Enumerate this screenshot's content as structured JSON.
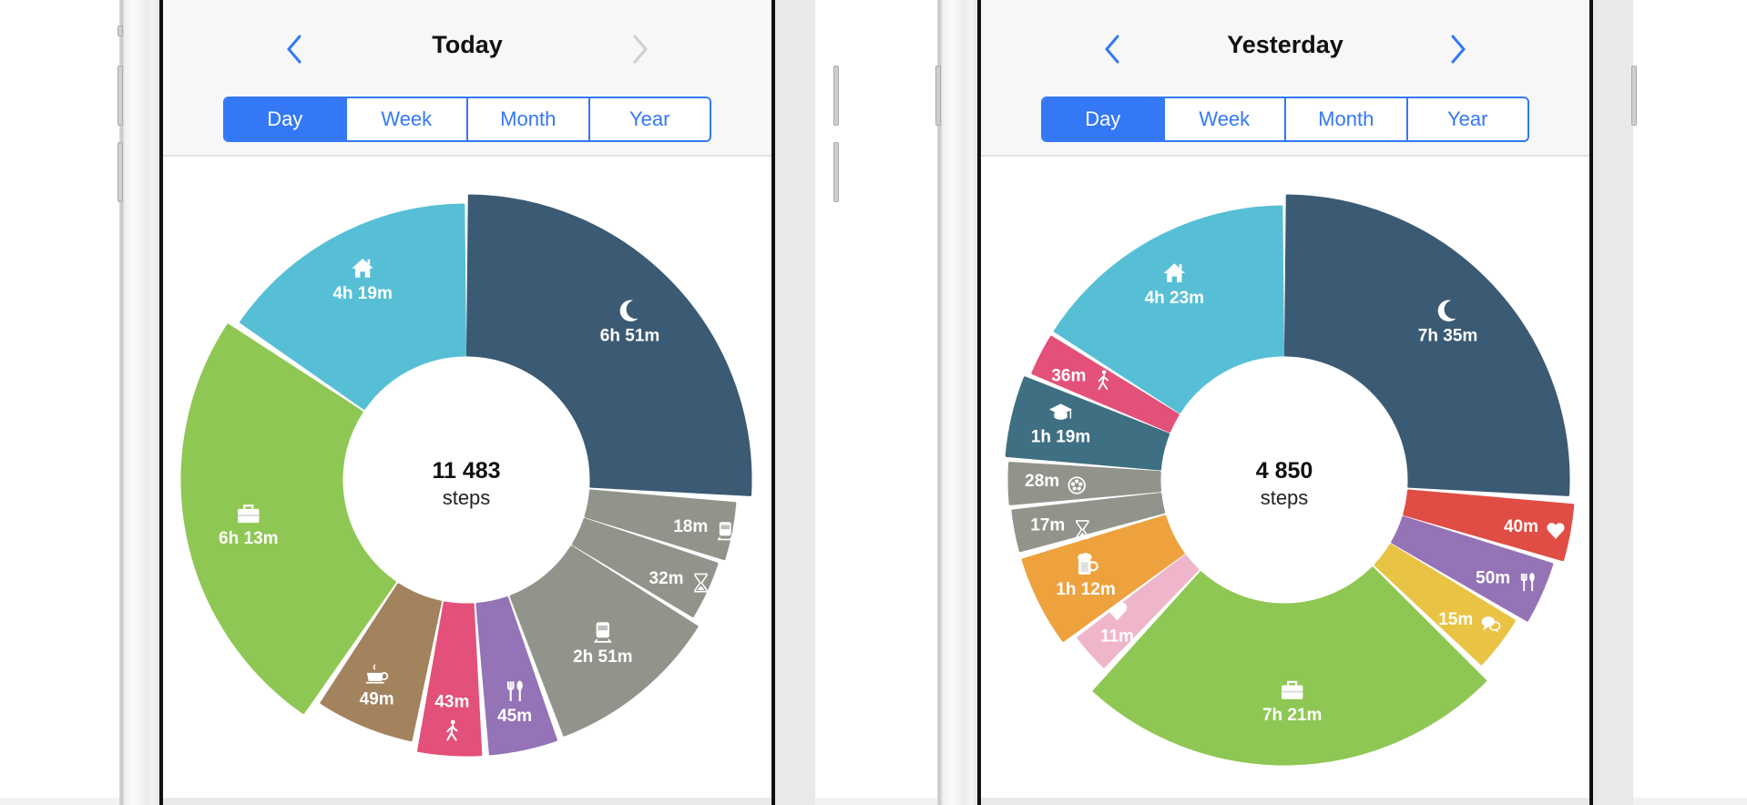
{
  "colors": {
    "accent": "#3478f6",
    "disabled_chevron": "#d0d0d0",
    "sleep": "#3b5a74",
    "home": "#56bfd6",
    "work": "#8fc754",
    "transport": "#91948b",
    "coffee": "#a3825e",
    "walk": "#e35079",
    "food": "#9473b6",
    "heart_red": "#df4d45",
    "chat": "#e9c343",
    "beer": "#eda23e",
    "heart_pink": "#efb6cb",
    "study": "#3f6f82"
  },
  "screens": [
    {
      "title": "Today",
      "prev_enabled": true,
      "next_enabled": false,
      "segments": [
        {
          "label": "Day",
          "active": true
        },
        {
          "label": "Week",
          "active": false
        },
        {
          "label": "Month",
          "active": false
        },
        {
          "label": "Year",
          "active": false
        }
      ],
      "center": {
        "value": "11 483",
        "unit": "steps"
      }
    },
    {
      "title": "Yesterday",
      "prev_enabled": true,
      "next_enabled": true,
      "segments": [
        {
          "label": "Day",
          "active": true
        },
        {
          "label": "Week",
          "active": false
        },
        {
          "label": "Month",
          "active": false
        },
        {
          "label": "Year",
          "active": false
        }
      ],
      "center": {
        "value": "4 850",
        "unit": "steps"
      }
    }
  ],
  "chart_data": [
    {
      "type": "pie",
      "variant": "donut",
      "title": "Today",
      "center_text": "11 483 steps",
      "slices": [
        {
          "label": "6h 51m",
          "minutes": 411,
          "category": "sleep",
          "icon": "moon",
          "color": "#3b5a74"
        },
        {
          "label": "18m",
          "minutes": 18,
          "category": "train",
          "icon": "train",
          "color": "#91948b"
        },
        {
          "label": "32m",
          "minutes": 32,
          "category": "waiting",
          "icon": "hourglass",
          "color": "#91948b"
        },
        {
          "label": "2h 51m",
          "minutes": 171,
          "category": "train",
          "icon": "train",
          "color": "#91948b"
        },
        {
          "label": "45m",
          "minutes": 45,
          "category": "food",
          "icon": "fork-spoon",
          "color": "#9473b6"
        },
        {
          "label": "43m",
          "minutes": 43,
          "category": "walk",
          "icon": "walk",
          "color": "#e35079"
        },
        {
          "label": "49m",
          "minutes": 49,
          "category": "coffee",
          "icon": "coffee",
          "color": "#a3825e"
        },
        {
          "label": "6h 13m",
          "minutes": 373,
          "category": "work",
          "icon": "briefcase",
          "color": "#8fc754"
        },
        {
          "label": "4h 19m",
          "minutes": 259,
          "category": "home",
          "icon": "home",
          "color": "#56bfd6"
        }
      ]
    },
    {
      "type": "pie",
      "variant": "donut",
      "title": "Yesterday",
      "center_text": "4 850 steps",
      "slices": [
        {
          "label": "7h 35m",
          "minutes": 455,
          "category": "sleep",
          "icon": "moon",
          "color": "#3b5a74"
        },
        {
          "label": "40m",
          "minutes": 40,
          "category": "health",
          "icon": "heart",
          "color": "#df4d45"
        },
        {
          "label": "50m",
          "minutes": 50,
          "category": "food",
          "icon": "fork-spoon",
          "color": "#9473b6"
        },
        {
          "label": "15m",
          "minutes": 15,
          "category": "chat",
          "icon": "chat",
          "color": "#e9c343"
        },
        {
          "label": "7h 21m",
          "minutes": 441,
          "category": "work",
          "icon": "briefcase",
          "color": "#8fc754"
        },
        {
          "label": "11m",
          "minutes": 11,
          "category": "love",
          "icon": "heart",
          "color": "#efb6cb"
        },
        {
          "label": "1h 12m",
          "minutes": 72,
          "category": "beer",
          "icon": "beer",
          "color": "#eda23e"
        },
        {
          "label": "17m",
          "minutes": 17,
          "category": "waiting",
          "icon": "hourglass",
          "color": "#91948b"
        },
        {
          "label": "28m",
          "minutes": 28,
          "category": "film",
          "icon": "film",
          "color": "#91948b"
        },
        {
          "label": "1h 19m",
          "minutes": 79,
          "category": "study",
          "icon": "graduation-cap",
          "color": "#3f6f82"
        },
        {
          "label": "36m",
          "minutes": 36,
          "category": "walk",
          "icon": "walk",
          "color": "#e35079"
        },
        {
          "label": "4h 23m",
          "minutes": 263,
          "category": "home",
          "icon": "home",
          "color": "#56bfd6"
        }
      ]
    }
  ]
}
